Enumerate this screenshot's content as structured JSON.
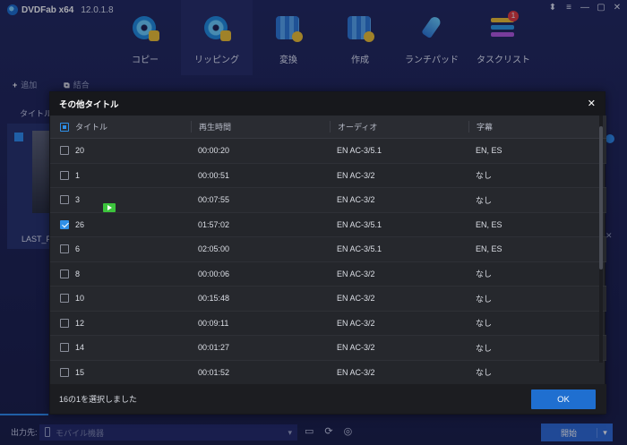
{
  "app": {
    "name": "DVDFab x64",
    "version": "12.0.1.8",
    "window_controls": [
      "⬍",
      "≡",
      "—",
      "▢",
      "✕"
    ],
    "nav": [
      {
        "label": "コピー",
        "icon": "disc-copy-icon"
      },
      {
        "label": "リッピング",
        "icon": "disc-ripper-icon",
        "active": true
      },
      {
        "label": "変換",
        "icon": "film-convert-icon"
      },
      {
        "label": "作成",
        "icon": "disc-create-icon"
      },
      {
        "label": "ランチパッド",
        "icon": "rocket-icon"
      },
      {
        "label": "タスクリスト",
        "icon": "task-list-icon",
        "badge": "1"
      }
    ],
    "subbar": {
      "add": "追加",
      "merge": "結合"
    },
    "column_title": "タイトル",
    "source_label": "LAST_F",
    "bottom": {
      "output_label": "出力先:",
      "device_placeholder": "モバイル機器",
      "start_label": "開始"
    }
  },
  "dialog": {
    "title": "その他タイトル",
    "columns": {
      "title": "タイトル",
      "duration": "再生時間",
      "audio": "オーディオ",
      "subtitle": "字幕"
    },
    "rows": [
      {
        "title": "20",
        "duration": "00:00:20",
        "audio": "EN AC-3/5.1",
        "subtitle": "EN, ES",
        "checked": false
      },
      {
        "title": "1",
        "duration": "00:00:51",
        "audio": "EN AC-3/2",
        "subtitle": "なし",
        "checked": false
      },
      {
        "title": "3",
        "duration": "00:07:55",
        "audio": "EN AC-3/2",
        "subtitle": "なし",
        "checked": false,
        "playing": true
      },
      {
        "title": "26",
        "duration": "01:57:02",
        "audio": "EN AC-3/5.1",
        "subtitle": "EN, ES",
        "checked": true
      },
      {
        "title": "6",
        "duration": "02:05:00",
        "audio": "EN AC-3/5.1",
        "subtitle": "EN, ES",
        "checked": false
      },
      {
        "title": "8",
        "duration": "00:00:06",
        "audio": "EN AC-3/2",
        "subtitle": "なし",
        "checked": false
      },
      {
        "title": "10",
        "duration": "00:15:48",
        "audio": "EN AC-3/2",
        "subtitle": "なし",
        "checked": false
      },
      {
        "title": "12",
        "duration": "00:09:11",
        "audio": "EN AC-3/2",
        "subtitle": "なし",
        "checked": false
      },
      {
        "title": "14",
        "duration": "00:01:27",
        "audio": "EN AC-3/2",
        "subtitle": "なし",
        "checked": false
      },
      {
        "title": "15",
        "duration": "00:01:52",
        "audio": "EN AC-3/2",
        "subtitle": "なし",
        "checked": false
      }
    ],
    "selection_status": "16の1を選択しました",
    "ok_label": "OK"
  },
  "colors": {
    "accent": "#2f8fe6",
    "app_bg": "#1c2150",
    "dialog_bg": "#24262b",
    "play_green": "#3cc43c",
    "badge_red": "#e5383b"
  }
}
